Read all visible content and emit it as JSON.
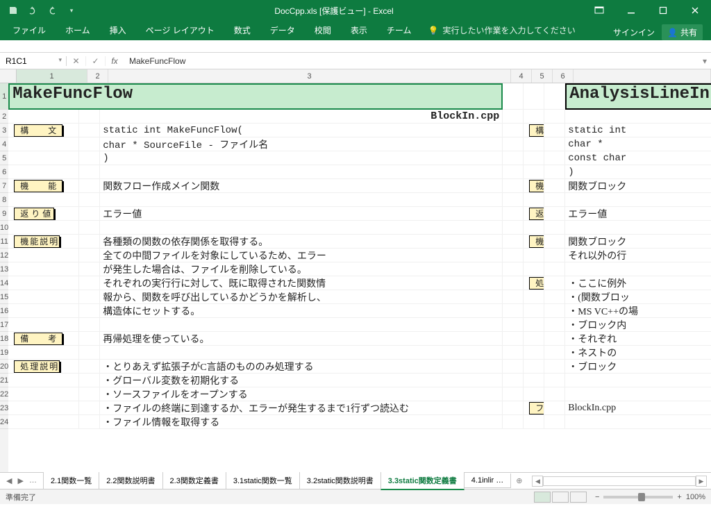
{
  "titlebar": {
    "title": "DocCpp.xls  [保護ビュー] - Excel"
  },
  "ribbon": {
    "tabs": [
      "ファイル",
      "ホーム",
      "挿入",
      "ページ レイアウト",
      "数式",
      "データ",
      "校閲",
      "表示",
      "チーム"
    ],
    "tellme_placeholder": "実行したい作業を入力してください",
    "signin": "サインイン",
    "share": "共有"
  },
  "namebox": "R1C1",
  "formula": "MakeFuncFlow",
  "columns": [
    "1",
    "2",
    "3",
    "4",
    "5",
    "6"
  ],
  "rows_visible": 24,
  "left": {
    "title": "MakeFuncFlow",
    "filename": "BlockIn.cpp",
    "labels": {
      "syntax": "構　文",
      "function": "機　能",
      "retval": "返り値",
      "descfunc": "機能説明",
      "remarks": "備　考",
      "procdesc": "処理説明"
    },
    "syntax": [
      "static int MakeFuncFlow(",
      "  char * SourceFile   - ファイル名",
      ")"
    ],
    "function_text": "関数フロー作成メイン関数",
    "retval_text": "エラー値",
    "descfunc_lines": [
      "各種類の関数の依存関係を取得する。",
      "全ての中間ファイルを対象にしているため、エラー",
      "が発生した場合は、ファイルを削除している。",
      "それぞれの実行行に対して、既に取得された関数情",
      "報から、関数を呼び出しているかどうかを解析し、",
      "構造体にセットする。"
    ],
    "remarks_text": "再帰処理を使っている。",
    "proc_lines": [
      "・とりあえず拡張子がC言語のもののみ処理する",
      "・グローバル変数を初期化する",
      "・ソースファイルをオープンする",
      "・ファイルの終端に到達するか、エラーが発生するまで1行ずつ読込む",
      "  ・ファイル情報を取得する"
    ]
  },
  "right": {
    "title": "AnalysisLineIn",
    "labels": {
      "syntax": "構　文",
      "function": "機　能",
      "retval": "返り値",
      "descfunc": "機能説明",
      "procdesc": "処理説明",
      "filename": "ファイル名"
    },
    "syntax": [
      "static int",
      "  char *",
      "  const char",
      ")"
    ],
    "function_text": "関数ブロック",
    "retval_text": "エラー値",
    "descfunc_lines": [
      "関数ブロック",
      "それ以外の行"
    ],
    "proc_lines": [
      "・ここに例外",
      "・(関数ブロッ",
      "・MS VC++の場",
      "・ブロック内",
      "  ・それぞれ",
      "  ・ネストの",
      "  ・ブロック"
    ],
    "filename_text": "BlockIn.cpp"
  },
  "sheets": {
    "tabs": [
      "2.1関数一覧",
      "2.2関数説明書",
      "2.3関数定義書",
      "3.1static関数一覧",
      "3.2static関数説明書",
      "3.3static関数定義書",
      "4.1inlir"
    ],
    "active_index": 5,
    "more_hint": "…"
  },
  "status": {
    "ready": "準備完了",
    "zoom": "100%"
  }
}
